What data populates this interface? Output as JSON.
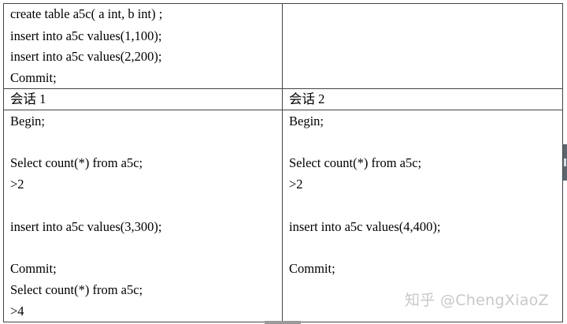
{
  "setup": {
    "lines": [
      "create table a5c( a int, b int) ;",
      "insert into a5c values(1,100);",
      "insert into a5c values(2,200);",
      "Commit;"
    ]
  },
  "sessions": {
    "session1": {
      "header": "会话 1",
      "lines": [
        "Begin;",
        "",
        "Select count(*) from a5c;",
        ">2",
        "",
        "insert into a5c values(3,300);",
        "",
        "Commit;",
        "Select count(*) from a5c;",
        ">4"
      ]
    },
    "session2": {
      "header": "会话 2",
      "lines": [
        "Begin;",
        "",
        "Select count(*) from a5c;",
        ">2",
        "",
        "insert into a5c values(4,400);",
        "",
        "Commit;"
      ]
    }
  },
  "watermark": "知乎 @ChengXiaoZ"
}
